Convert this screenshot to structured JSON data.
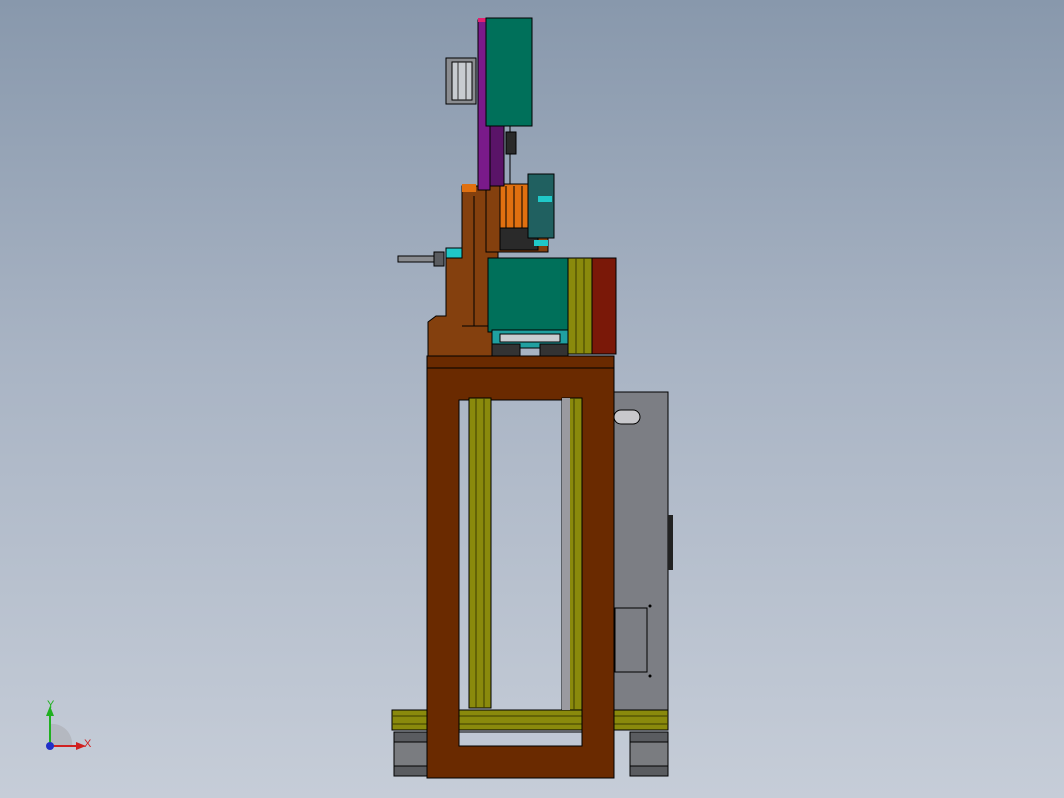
{
  "triad": {
    "x_label": "X",
    "y_label": "Y",
    "x_color": "#d02020",
    "y_color": "#20b020",
    "z_color": "#2030c8"
  },
  "colors": {
    "frame_brown": "#6a2a00",
    "bracket_brown": "#84400e",
    "olive_rail": "#8a8a0c",
    "teal_block": "#00705a",
    "purple_plate": "#7a1a8a",
    "orange_part": "#e07010",
    "grey_cabinet": "#7c7e84",
    "cyan_part": "#20c8c8",
    "red_plate": "#7a1808"
  }
}
